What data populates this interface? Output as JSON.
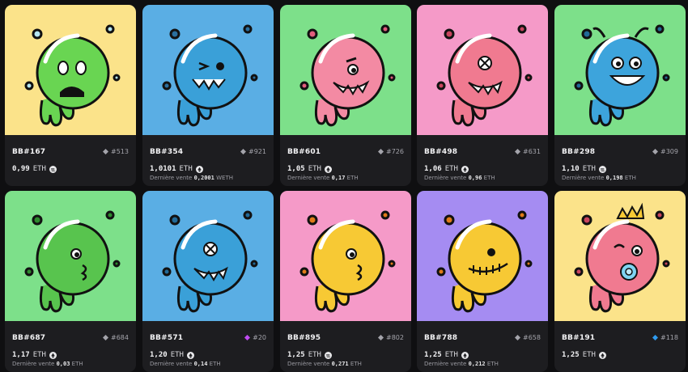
{
  "items": [
    {
      "name": "BB#167",
      "rank": "#513",
      "rank_type": "gray",
      "price": "0,99",
      "currency": "ETH",
      "coin": "sol",
      "last_label": "",
      "last_value": "",
      "last_currency": "",
      "bg": "#fbe38a",
      "body": "#69d552",
      "accent": "#b5e6f2",
      "eye": "sad"
    },
    {
      "name": "BB#354",
      "rank": "#921",
      "rank_type": "gray",
      "price": "1,0101",
      "currency": "ETH",
      "coin": "eth",
      "last_label": "Dernière vente",
      "last_value": "0,2001",
      "last_currency": "WETH",
      "bg": "#5aaee4",
      "body": "#3aa0d8",
      "accent": "#2b6f9e",
      "eye": "wink"
    },
    {
      "name": "BB#601",
      "rank": "#726",
      "rank_type": "gray",
      "price": "1,05",
      "currency": "ETH",
      "coin": "eth",
      "last_label": "Dernière vente",
      "last_value": "0,17",
      "last_currency": "ETH",
      "bg": "#7de08a",
      "body": "#f38aa3",
      "accent": "#e15d7c",
      "eye": "angry"
    },
    {
      "name": "BB#498",
      "rank": "#631",
      "rank_type": "gray",
      "price": "1,06",
      "currency": "ETH",
      "coin": "eth",
      "last_label": "Dernière vente",
      "last_value": "0,96",
      "last_currency": "ETH",
      "bg": "#f59ac8",
      "body": "#f07a90",
      "accent": "#c9455e",
      "eye": "x"
    },
    {
      "name": "BB#298",
      "rank": "#309",
      "rank_type": "gray",
      "price": "1,10",
      "currency": "ETH",
      "coin": "sol",
      "last_label": "Dernière vente",
      "last_value": "0,198",
      "last_currency": "ETH",
      "bg": "#7de08a",
      "body": "#3da4dc",
      "accent": "#226a98",
      "eye": "happy"
    },
    {
      "name": "BB#687",
      "rank": "#684",
      "rank_type": "gray",
      "price": "1,17",
      "currency": "ETH",
      "coin": "eth",
      "last_label": "Dernière vente",
      "last_value": "0,03",
      "last_currency": "ETH",
      "bg": "#7de08a",
      "body": "#58c44e",
      "accent": "#2e8a2e",
      "eye": "pout"
    },
    {
      "name": "BB#571",
      "rank": "#20",
      "rank_type": "purple",
      "price": "1,20",
      "currency": "ETH",
      "coin": "eth",
      "last_label": "Dernière vente",
      "last_value": "0,14",
      "last_currency": "ETH",
      "bg": "#5aaee4",
      "body": "#3aa0d8",
      "accent": "#226a98",
      "eye": "x"
    },
    {
      "name": "BB#895",
      "rank": "#802",
      "rank_type": "gray",
      "price": "1,25",
      "currency": "ETH",
      "coin": "sol",
      "last_label": "Dernière vente",
      "last_value": "0,271",
      "last_currency": "ETH",
      "bg": "#f59ac8",
      "body": "#f7c934",
      "accent": "#e07a1a",
      "eye": "pout"
    },
    {
      "name": "BB#788",
      "rank": "#658",
      "rank_type": "gray",
      "price": "1,25",
      "currency": "ETH",
      "coin": "eth",
      "last_label": "Dernière vente",
      "last_value": "0,212",
      "last_currency": "ETH",
      "bg": "#a58cf2",
      "body": "#f7c934",
      "accent": "#e07a1a",
      "eye": "stitch"
    },
    {
      "name": "BB#191",
      "rank": "#118",
      "rank_type": "blue",
      "price": "1,25",
      "currency": "ETH",
      "coin": "eth",
      "last_label": "",
      "last_value": "",
      "last_currency": "",
      "bg": "#fbe38a",
      "body": "#f07a90",
      "accent": "#c9455e",
      "eye": "baby"
    }
  ],
  "colors": {
    "card_bg": "#1d1d20",
    "page_bg": "#0f0f11",
    "gray_gem": "#a4a4ab",
    "purple_gem": "#c04bf2",
    "blue_gem": "#2f9bf0"
  },
  "icons": {
    "rank": "diamond-icon",
    "eth": "eth-coin-icon",
    "sol": "solana-coin-icon"
  }
}
